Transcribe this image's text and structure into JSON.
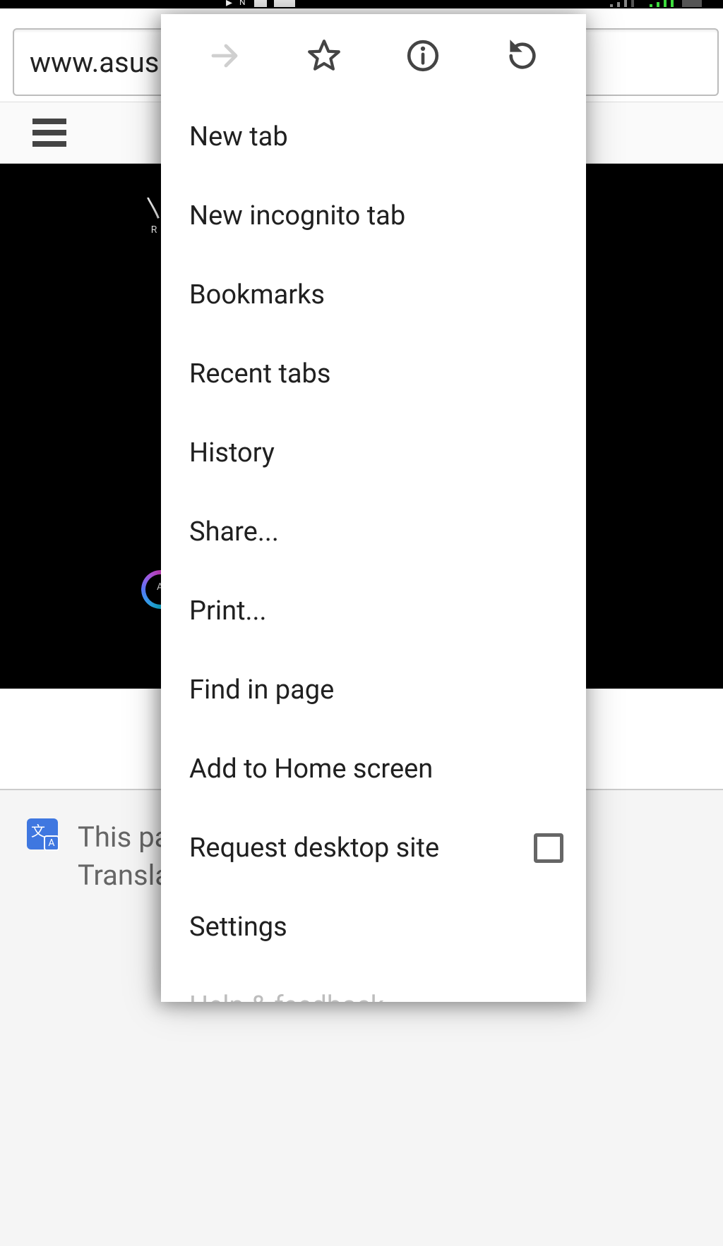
{
  "url_bar": {
    "value": "www.asus."
  },
  "page": {
    "rog_line1": "RE",
    "rog_line2": "",
    "aura_letter": "A"
  },
  "translate": {
    "line1": "This pa",
    "line2": "Transla"
  },
  "menu": {
    "items": [
      {
        "label": "New tab"
      },
      {
        "label": "New incognito tab"
      },
      {
        "label": "Bookmarks"
      },
      {
        "label": "Recent tabs"
      },
      {
        "label": "History"
      },
      {
        "label": "Share..."
      },
      {
        "label": "Print..."
      },
      {
        "label": "Find in page"
      },
      {
        "label": "Add to Home screen"
      },
      {
        "label": "Request desktop site",
        "checkbox": true,
        "checked": false
      },
      {
        "label": "Settings"
      },
      {
        "label": "Help & feedback",
        "faded": true
      }
    ]
  }
}
